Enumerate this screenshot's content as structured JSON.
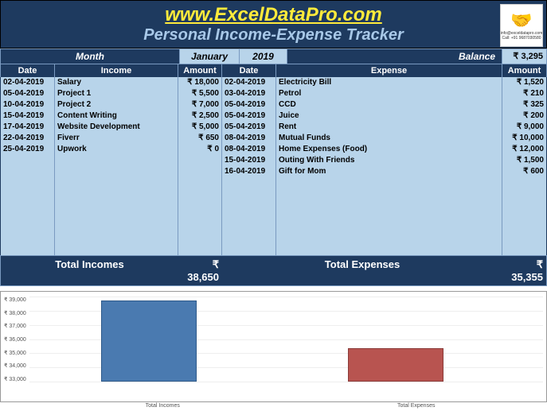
{
  "header": {
    "title": "www.ExcelDataPro.com",
    "subtitle": "Personal Income-Expense Tracker",
    "logo_line1": "info@exceldatapro.com",
    "logo_line2": "Call: +91 9687030580"
  },
  "period": {
    "month_label": "Month",
    "month": "January",
    "year": "2019",
    "balance_label": "Balance",
    "balance": "₹ 3,295"
  },
  "columns": {
    "date": "Date",
    "income": "Income",
    "amount": "Amount",
    "date2": "Date",
    "expense": "Expense",
    "amount2": "Amount"
  },
  "incomes": [
    {
      "date": "02-04-2019",
      "desc": "Salary",
      "amount": "₹ 18,000"
    },
    {
      "date": "05-04-2019",
      "desc": "Project 1",
      "amount": "₹ 5,500"
    },
    {
      "date": "10-04-2019",
      "desc": "Project 2",
      "amount": "₹ 7,000"
    },
    {
      "date": "15-04-2019",
      "desc": "Content Writing",
      "amount": "₹ 2,500"
    },
    {
      "date": "17-04-2019",
      "desc": "Website Development",
      "amount": "₹ 5,000"
    },
    {
      "date": "22-04-2019",
      "desc": "Fiverr",
      "amount": "₹ 650"
    },
    {
      "date": "25-04-2019",
      "desc": "Upwork",
      "amount": "₹ 0"
    }
  ],
  "expenses": [
    {
      "date": "02-04-2019",
      "desc": "Electricity Bill",
      "amount": "₹ 1,520"
    },
    {
      "date": "03-04-2019",
      "desc": "Petrol",
      "amount": "₹ 210"
    },
    {
      "date": "05-04-2019",
      "desc": "CCD",
      "amount": "₹ 325"
    },
    {
      "date": "05-04-2019",
      "desc": "Juice",
      "amount": "₹ 200"
    },
    {
      "date": "05-04-2019",
      "desc": "Rent",
      "amount": "₹ 9,000"
    },
    {
      "date": "08-04-2019",
      "desc": "Mutual Funds",
      "amount": "₹ 10,000"
    },
    {
      "date": "08-04-2019",
      "desc": "Home Expenses (Food)",
      "amount": "₹ 12,000"
    },
    {
      "date": "15-04-2019",
      "desc": "Outing With Friends",
      "amount": "₹ 1,500"
    },
    {
      "date": "16-04-2019",
      "desc": "Gift for Mom",
      "amount": "₹ 600"
    }
  ],
  "totals": {
    "income_label": "Total Incomes",
    "income_value": "₹ 38,650",
    "expense_label": "Total Expenses",
    "expense_value": "₹ 35,355"
  },
  "chart_data": {
    "type": "bar",
    "categories": [
      "Total Incomes",
      "Total Expenses"
    ],
    "values": [
      38650,
      35355
    ],
    "colors": [
      "#4a7ab0",
      "#b85450"
    ],
    "ylim": [
      33000,
      39000
    ],
    "yticks": [
      "₹ 39,000",
      "₹ 38,000",
      "₹ 37,000",
      "₹ 36,000",
      "₹ 35,000",
      "₹ 34,000",
      "₹ 33,000"
    ]
  }
}
